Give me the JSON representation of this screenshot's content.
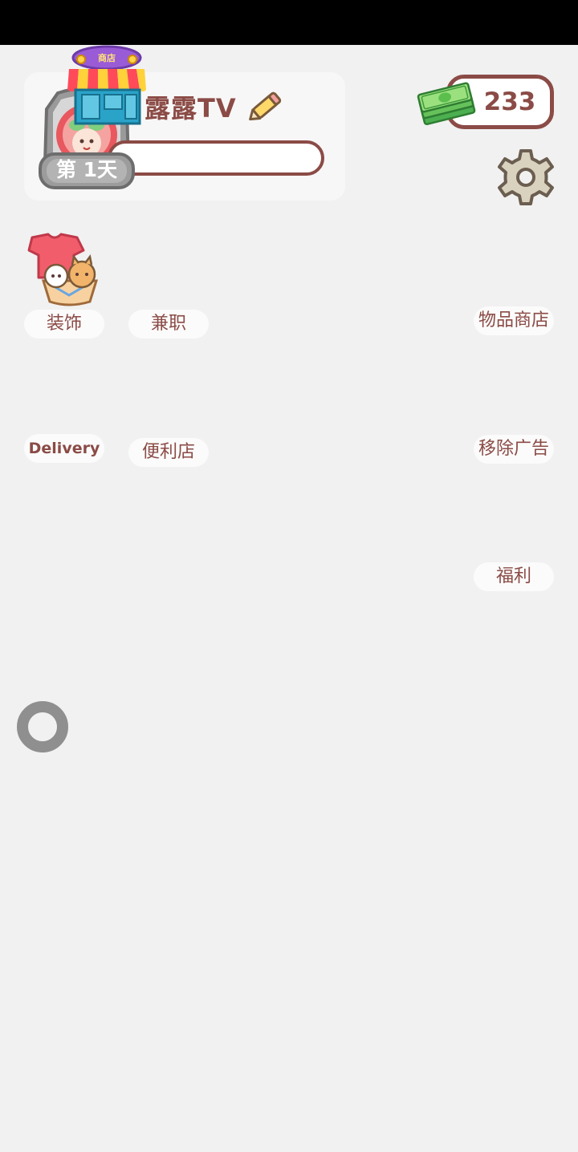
{
  "profile": {
    "name": "露露TV",
    "day_label": "第 1天",
    "shop_sign": "商店"
  },
  "wallet": {
    "money": "233"
  },
  "menu": {
    "decorate": "装饰",
    "part_time": "兼职",
    "item_shop": "物品商店",
    "delivery": "Delivery",
    "convenience_store": "便利店",
    "remove_ads": "移除广告",
    "welfare": "福利"
  },
  "colors": {
    "text_brown": "#8b4b46",
    "background": "#f1f1f1",
    "status_bar": "#000000"
  },
  "icons": {
    "shop": "shop-icon",
    "edit": "pencil-icon",
    "cash": "cash-stack-icon",
    "settings": "gear-icon",
    "decorate": "clothes-basket-icon",
    "loading": "loading-ring-icon"
  }
}
